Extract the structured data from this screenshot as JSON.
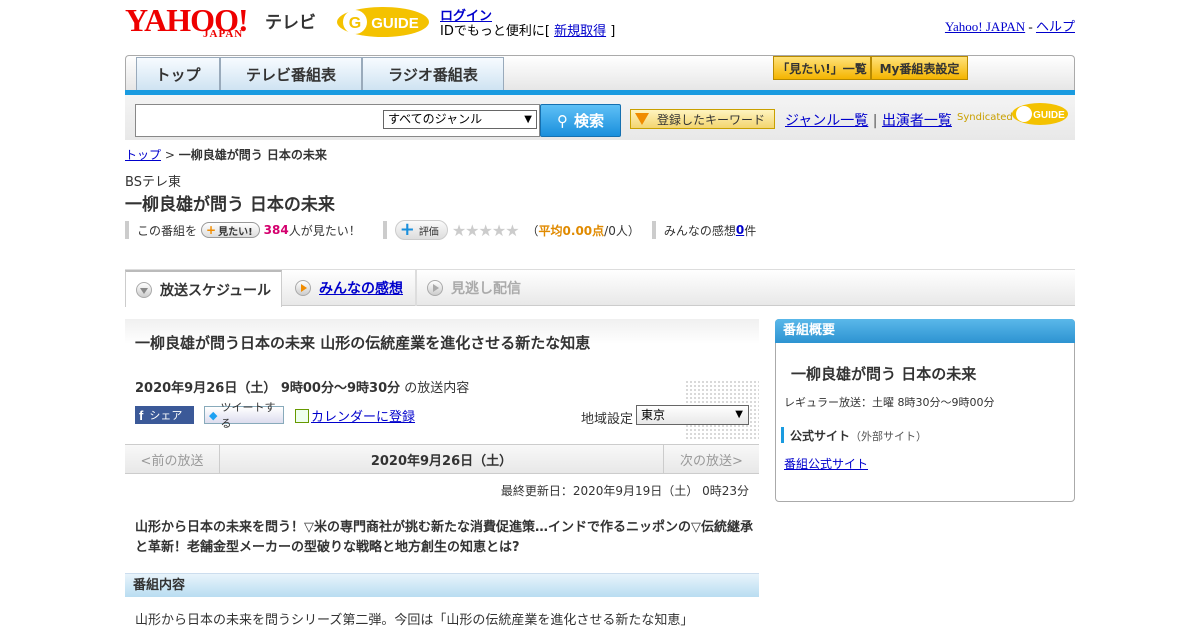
{
  "header": {
    "yahoo": "YAHOO!",
    "japan": "JAPAN",
    "tv": "テレビ",
    "gguide": "GUIDE",
    "login": "ログイン",
    "id_prefix": "IDでもっと便利に[ ",
    "register": "新規取得",
    "id_suffix": " ]",
    "yahoo_japan": "Yahoo! JAPAN",
    "sep": " - ",
    "help": "ヘルプ"
  },
  "nav": {
    "tabs": [
      "トップ",
      "テレビ番組表",
      "ラジオ番組表"
    ],
    "mitai_list": "「見たい!」一覧",
    "my_table": "My番組表設定"
  },
  "search": {
    "genre": "すべてのジャンル",
    "button": "検索",
    "keyword": "登録したキーワード",
    "genre_list": "ジャンル一覧",
    "divider": " | ",
    "cast_list": "出演者一覧",
    "syndicated": "Syndicated"
  },
  "crumb": {
    "top": "トップ",
    "sep": " > ",
    "current": "一柳良雄が問う 日本の未来"
  },
  "program": {
    "channel": "BSテレ東",
    "title": "一柳良雄が問う 日本の未来",
    "this_prog": "この番組を",
    "mitai": "見たい!",
    "count": "384",
    "count_suffix": "人が見たい！",
    "rating_label": "評価",
    "stars": "★★★★★",
    "rating_prefix": "（",
    "rating": "平均0.00点",
    "rating_suffix": "/0人）",
    "kansou": "みんなの感想 ",
    "kansou_count": "0",
    "kansou_unit": "件"
  },
  "tabs": {
    "schedule": "放送スケジュール",
    "reviews": "みんなの感想",
    "stream": "見逃し配信"
  },
  "episode": {
    "title": "一柳良雄が問う日本の未来 山形の伝統産業を進化させる新たな知恵",
    "date": "2020年9月26日（土） 9時00分～9時30分",
    "date_suffix": " の放送内容",
    "share": "シェア",
    "tweet": "ツイートする",
    "calendar": "カレンダーに登録",
    "region_label": "地域設定",
    "region": "東京",
    "prev": "<前の放送",
    "current_date": "2020年9月26日（土）",
    "next": "次の放送>",
    "updated": "最終更新日：2020年9月19日（土） 0時23分",
    "summary": "山形から日本の未来を問う！▽米の専門商社が挑む新たな消費促進策…インドで作るニッポンの▽伝統継承と革新！老舗金型メーカーの型破りな戦略と地方創生の知恵とは?",
    "section": "番組内容",
    "detail": "山形から日本の未来を問うシリーズ第二弾。今回は「山形の伝統産業を進化させる新たな知恵」"
  },
  "side": {
    "head": "番組概要",
    "title": "一柳良雄が問う 日本の未来",
    "regular": "レギュラー放送：土曜 8時30分～9時00分",
    "official": "公式サイト",
    "external": "（外部サイト）",
    "official_link": "番組公式サイト"
  },
  "colors": {
    "accent_blue": "#1a9be0",
    "yahoo_red": "#e00000",
    "gold": "#f4b400",
    "pink": "#d4006e"
  }
}
